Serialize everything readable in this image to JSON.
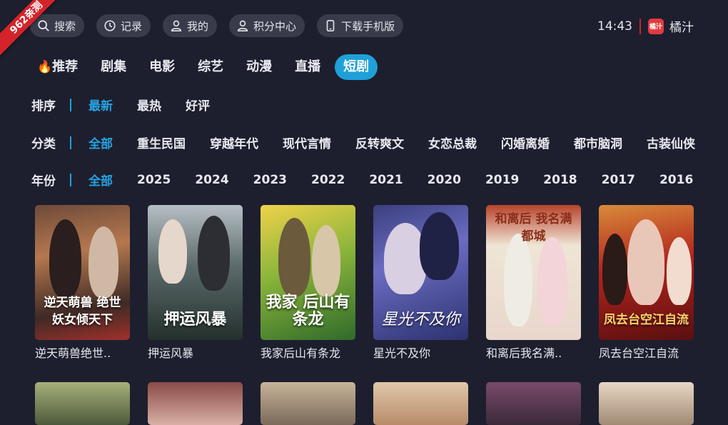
{
  "badge": "962亲测",
  "toolbar": {
    "buttons": [
      {
        "label": "搜索",
        "icon": "search-icon"
      },
      {
        "label": "记录",
        "icon": "history-icon"
      },
      {
        "label": "我的",
        "icon": "user-icon"
      },
      {
        "label": "积分中心",
        "icon": "user-icon"
      },
      {
        "label": "下载手机版",
        "icon": "phone-icon"
      }
    ]
  },
  "status": {
    "time": "14:43",
    "brand_logo": "橘汁",
    "brand": "橘汁"
  },
  "tabs": [
    {
      "label": "推荐",
      "icon": "fire-icon"
    },
    {
      "label": "剧集"
    },
    {
      "label": "电影"
    },
    {
      "label": "综艺"
    },
    {
      "label": "动漫"
    },
    {
      "label": "直播"
    },
    {
      "label": "短剧",
      "active": true
    }
  ],
  "filters": {
    "sort": {
      "label": "排序",
      "options": [
        "最新",
        "最热",
        "好评"
      ],
      "selected": 0
    },
    "category": {
      "label": "分类",
      "options": [
        "全部",
        "重生民国",
        "穿越年代",
        "现代言情",
        "反转爽文",
        "女恋总裁",
        "闪婚离婚",
        "都市脑洞",
        "古装仙侠"
      ],
      "selected": 0
    },
    "year": {
      "label": "年份",
      "options": [
        "全部",
        "2025",
        "2024",
        "2023",
        "2022",
        "2021",
        "2020",
        "2019",
        "2018",
        "2017",
        "2016"
      ],
      "selected": 0
    }
  },
  "items": [
    {
      "title": "逆天萌兽绝世..",
      "poster_text": "逆天萌兽 绝世妖女倾天下"
    },
    {
      "title": "押运风暴",
      "poster_text": "押运风暴"
    },
    {
      "title": "我家后山有条龙",
      "poster_text": "我家 后山有条龙"
    },
    {
      "title": "星光不及你",
      "poster_text": "星光不及你"
    },
    {
      "title": "和离后我名满..",
      "poster_text": "和离后 我名满都城"
    },
    {
      "title": "凤去台空江自流",
      "poster_text": "凤去台空江自流"
    }
  ],
  "colors": {
    "accent": "#1fa0d8",
    "background": "#1d1f2e",
    "ribbon": "#d4232a"
  }
}
